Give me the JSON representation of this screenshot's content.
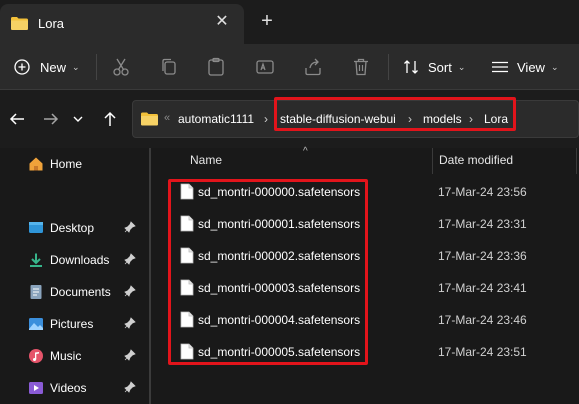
{
  "window": {
    "tab_title": "Lora",
    "close_glyph": "✕",
    "new_tab_glyph": "+"
  },
  "toolbar": {
    "new_label": "New",
    "sort_label": "Sort",
    "view_label": "View",
    "chevron": "⌄"
  },
  "address": {
    "overflow": "«",
    "crumbs": [
      "automatic1111",
      "stable-diffusion-webui",
      "models",
      "Lora"
    ],
    "separator": "›"
  },
  "sidebar": {
    "home_label": "Home",
    "items": [
      {
        "label": "Desktop",
        "icon": "desktop-icon"
      },
      {
        "label": "Downloads",
        "icon": "download-icon"
      },
      {
        "label": "Documents",
        "icon": "document-icon"
      },
      {
        "label": "Pictures",
        "icon": "picture-icon"
      },
      {
        "label": "Music",
        "icon": "music-icon"
      },
      {
        "label": "Videos",
        "icon": "video-icon"
      }
    ]
  },
  "columns": {
    "name": "Name",
    "date_modified": "Date modified",
    "sort_caret": "^"
  },
  "files": [
    {
      "name": "sd_montri-000000.safetensors",
      "date": "17-Mar-24 23:56"
    },
    {
      "name": "sd_montri-000001.safetensors",
      "date": "17-Mar-24 23:31"
    },
    {
      "name": "sd_montri-000002.safetensors",
      "date": "17-Mar-24 23:36"
    },
    {
      "name": "sd_montri-000003.safetensors",
      "date": "17-Mar-24 23:41"
    },
    {
      "name": "sd_montri-000004.safetensors",
      "date": "17-Mar-24 23:46"
    },
    {
      "name": "sd_montri-000005.safetensors",
      "date": "17-Mar-24 23:51"
    }
  ],
  "colors": {
    "highlight": "#e2141b",
    "folder": "#f3c13a",
    "background": "#191919"
  }
}
